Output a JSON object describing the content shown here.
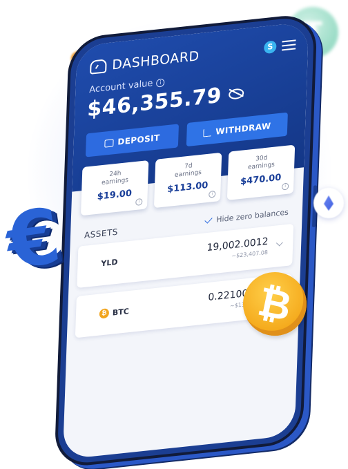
{
  "header": {
    "title": "DASHBOARD",
    "account_label": "Account value",
    "account_value": "$46,355.79"
  },
  "actions": {
    "deposit": "DEPOSIT",
    "withdraw": "WITHDRAW"
  },
  "earnings": [
    {
      "period": "24h",
      "label": "earnings",
      "value": "$19.00"
    },
    {
      "period": "7d",
      "label": "earnings",
      "value": "$113.00"
    },
    {
      "period": "30d",
      "label": "earnings",
      "value": "$470.00"
    }
  ],
  "assets": {
    "heading": "ASSETS",
    "hide_zero_label": "Hide zero balances",
    "hide_zero_checked": true,
    "items": [
      {
        "symbol": "YLD",
        "amount": "19,002.0012",
        "usd": "~$23,407.08"
      },
      {
        "symbol": "BTC",
        "amount": "0.22100012",
        "usd": "~$13,407.08"
      }
    ]
  },
  "decor": {
    "icons": [
      "pound-sign",
      "tether-coin",
      "euro-sign",
      "ethereum-coin",
      "bitcoin-coin"
    ],
    "colors": {
      "primary": "#1f4cad",
      "button": "#2d6be0",
      "bitcoin": "#f4a81a",
      "tether": "#88d6bc"
    }
  }
}
